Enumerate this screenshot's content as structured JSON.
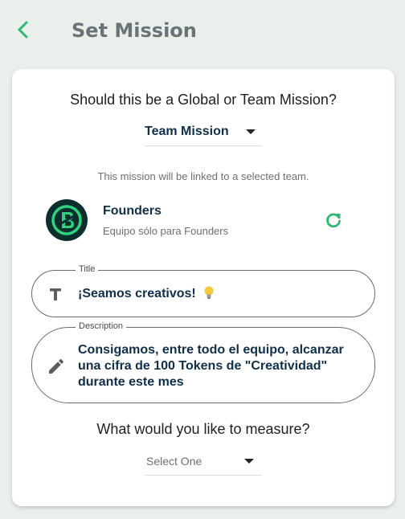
{
  "header": {
    "title": "Set Mission",
    "back_icon": "chevron-left-icon",
    "accent_color": "#2fb872"
  },
  "mission_type": {
    "question": "Should this be a Global or Team Mission?",
    "selected": "Team Mission",
    "helper": "This mission will be linked to a selected team."
  },
  "team": {
    "name": "Founders",
    "subtitle": "Equipo sólo para Founders",
    "avatar_icon": "founders-logo-icon",
    "refresh_icon": "refresh-icon"
  },
  "title_field": {
    "label": "Title",
    "value": "¡Seamos creativos!",
    "icon": "text-format-icon",
    "emoji_icon": "lightbulb-icon"
  },
  "description_field": {
    "label": "Description",
    "value": "Consigamos, entre todo el equipo, alcanzar una cifra de 100 Tokens de \"Creatividad\" durante este mes",
    "icon": "pencil-icon"
  },
  "measure": {
    "question": "What would you like to measure?",
    "placeholder": "Select One"
  }
}
